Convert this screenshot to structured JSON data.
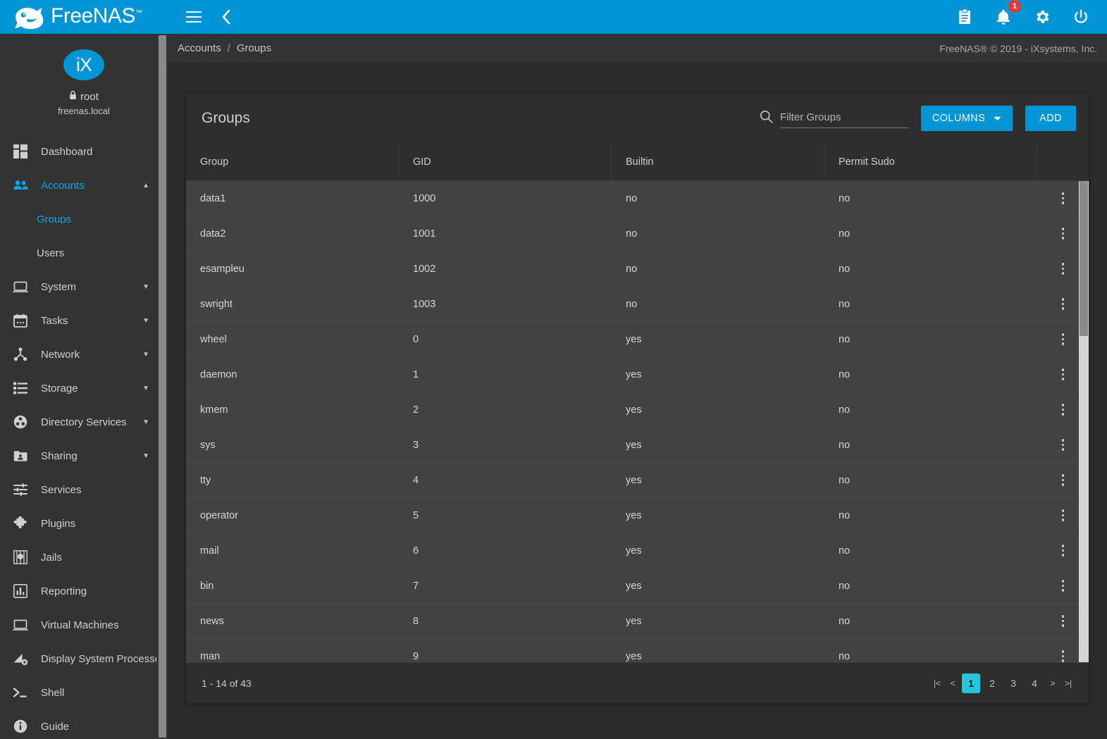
{
  "brand": {
    "name": "FreeNAS",
    "tm": "™"
  },
  "topbar": {
    "menu_icon": "hamburger-icon",
    "back_icon": "chevron-left-icon",
    "icons": [
      {
        "name": "task-manager-icon",
        "glyph": "clipboard"
      },
      {
        "name": "notifications-icon",
        "glyph": "bell",
        "badge": "1"
      },
      {
        "name": "settings-icon",
        "glyph": "gear"
      },
      {
        "name": "power-icon",
        "glyph": "power"
      }
    ]
  },
  "sidebar": {
    "avatar_text": "iX",
    "username": "root",
    "hostname": "freenas.local",
    "lock_icon": "lock-icon",
    "items": [
      {
        "label": "Dashboard",
        "icon": "dashboard-icon",
        "expandable": false,
        "active": false
      },
      {
        "label": "Accounts",
        "icon": "people-icon",
        "expandable": true,
        "expanded": true,
        "active": true
      },
      {
        "label": "System",
        "icon": "laptop-icon",
        "expandable": true,
        "active": false
      },
      {
        "label": "Tasks",
        "icon": "calendar-icon",
        "expandable": true,
        "active": false
      },
      {
        "label": "Network",
        "icon": "network-icon",
        "expandable": true,
        "active": false
      },
      {
        "label": "Storage",
        "icon": "storage-icon",
        "expandable": true,
        "active": false
      },
      {
        "label": "Directory Services",
        "icon": "directory-icon",
        "expandable": true,
        "active": false
      },
      {
        "label": "Sharing",
        "icon": "sharing-folder-icon",
        "expandable": true,
        "active": false
      },
      {
        "label": "Services",
        "icon": "sliders-icon",
        "expandable": false,
        "active": false
      },
      {
        "label": "Plugins",
        "icon": "puzzle-icon",
        "expandable": false,
        "active": false
      },
      {
        "label": "Jails",
        "icon": "jail-icon",
        "expandable": false,
        "active": false
      },
      {
        "label": "Reporting",
        "icon": "chart-bar-icon",
        "expandable": false,
        "active": false
      },
      {
        "label": "Virtual Machines",
        "icon": "monitor-icon",
        "expandable": false,
        "active": false
      },
      {
        "label": "Display System Processes",
        "icon": "processes-icon",
        "expandable": false,
        "active": false
      },
      {
        "label": "Shell",
        "icon": "terminal-icon",
        "expandable": false,
        "active": false
      },
      {
        "label": "Guide",
        "icon": "info-icon",
        "expandable": false,
        "active": false
      }
    ],
    "subitems": [
      {
        "label": "Groups",
        "active": true
      },
      {
        "label": "Users",
        "active": false
      }
    ]
  },
  "breadcrumb": {
    "parent": "Accounts",
    "separator": "/",
    "current": "Groups",
    "copyright": "FreeNAS® © 2019 - iXsystems, Inc."
  },
  "card": {
    "title": "Groups",
    "search": {
      "placeholder": "Filter Groups",
      "value": "",
      "icon": "search-icon"
    },
    "columns_button": "COLUMNS",
    "columns_caret_icon": "chevron-down-icon",
    "add_button": "ADD",
    "headers": [
      "Group",
      "GID",
      "Builtin",
      "Permit Sudo",
      ""
    ],
    "rows": [
      {
        "group": "data1",
        "gid": "1000",
        "builtin": "no",
        "sudo": "no"
      },
      {
        "group": "data2",
        "gid": "1001",
        "builtin": "no",
        "sudo": "no"
      },
      {
        "group": "esampleu",
        "gid": "1002",
        "builtin": "no",
        "sudo": "no"
      },
      {
        "group": "swright",
        "gid": "1003",
        "builtin": "no",
        "sudo": "no"
      },
      {
        "group": "wheel",
        "gid": "0",
        "builtin": "yes",
        "sudo": "no"
      },
      {
        "group": "daemon",
        "gid": "1",
        "builtin": "yes",
        "sudo": "no"
      },
      {
        "group": "kmem",
        "gid": "2",
        "builtin": "yes",
        "sudo": "no"
      },
      {
        "group": "sys",
        "gid": "3",
        "builtin": "yes",
        "sudo": "no"
      },
      {
        "group": "tty",
        "gid": "4",
        "builtin": "yes",
        "sudo": "no"
      },
      {
        "group": "operator",
        "gid": "5",
        "builtin": "yes",
        "sudo": "no"
      },
      {
        "group": "mail",
        "gid": "6",
        "builtin": "yes",
        "sudo": "no"
      },
      {
        "group": "bin",
        "gid": "7",
        "builtin": "yes",
        "sudo": "no"
      },
      {
        "group": "news",
        "gid": "8",
        "builtin": "yes",
        "sudo": "no"
      },
      {
        "group": "man",
        "gid": "9",
        "builtin": "yes",
        "sudo": "no"
      }
    ],
    "footer": {
      "range": "1 - 14 of 43",
      "pages": [
        "1",
        "2",
        "3",
        "4"
      ],
      "current_page": "1",
      "first_icon": "first-page-icon",
      "prev_icon": "prev-page-icon",
      "next_icon": "next-page-icon",
      "last_icon": "last-page-icon"
    }
  },
  "colors": {
    "accent_blue": "#0095d5",
    "active_page_cyan": "#26c6da",
    "badge_red": "#e53935",
    "sidebar_bg": "#333333",
    "row_bg": "#424242",
    "card_bg": "#2e2e2e"
  }
}
